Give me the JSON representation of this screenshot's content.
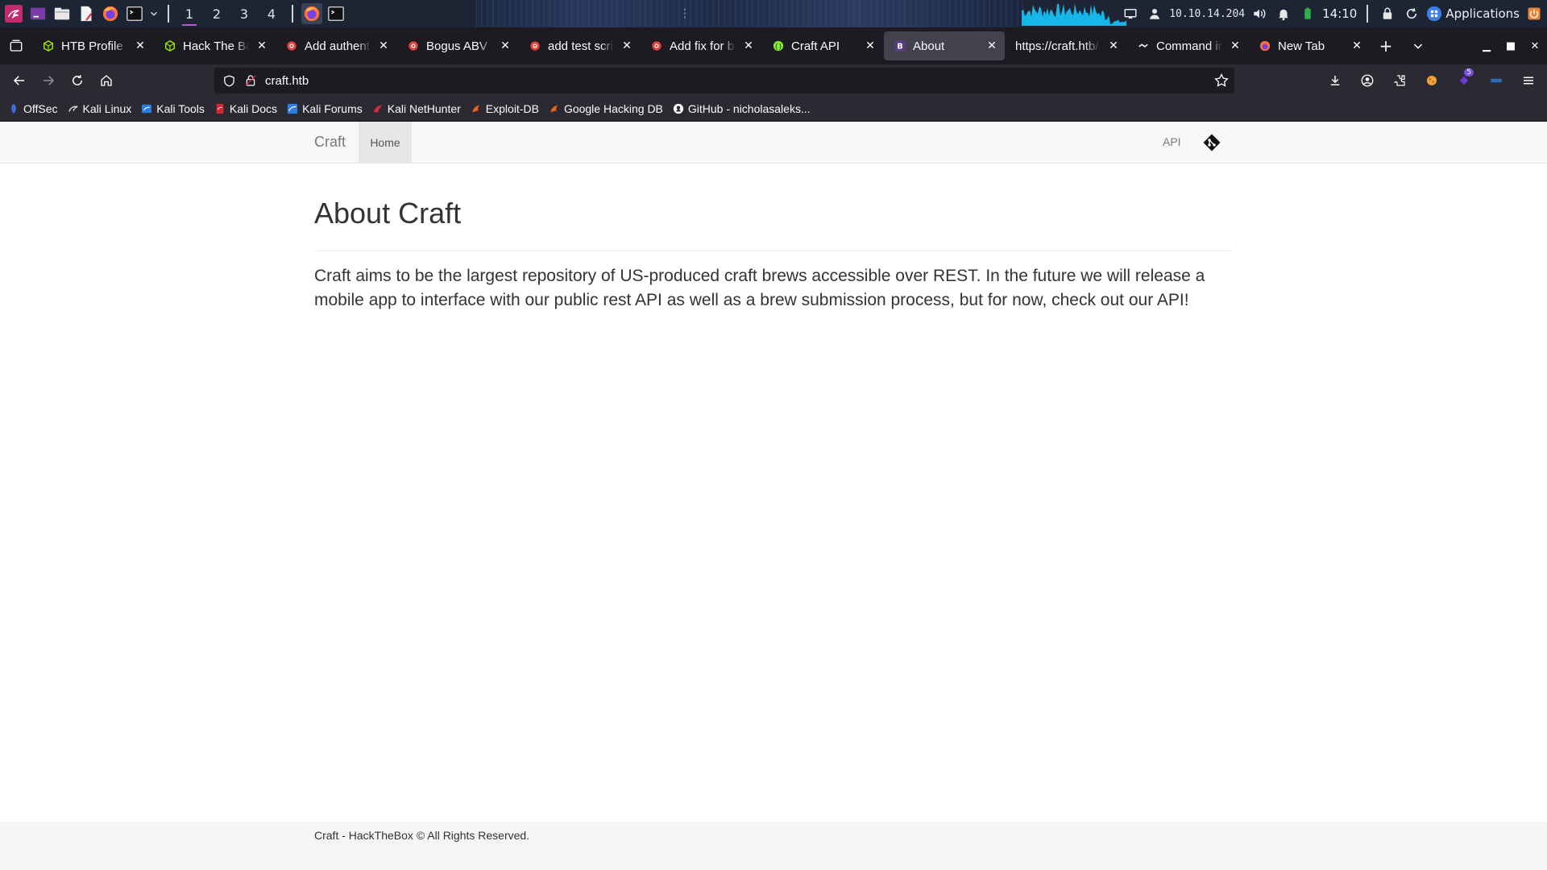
{
  "taskbar": {
    "workspaces": [
      "1",
      "2",
      "3",
      "4"
    ],
    "ip": "10.10.14.204",
    "clock": "14:10",
    "applications_label": "Applications"
  },
  "browser": {
    "tabs": [
      {
        "title": "HTB Profile | HTB",
        "icon": "htb-cube-icon"
      },
      {
        "title": "Hack The Box :: Hack The Box",
        "icon": "htb-cube-icon"
      },
      {
        "title": "Add authentication",
        "icon": "gogs-icon"
      },
      {
        "title": "Bogus ABV values",
        "icon": "gogs-icon"
      },
      {
        "title": "add test script",
        "icon": "gogs-icon"
      },
      {
        "title": "Add fix for bogus ABV",
        "icon": "gogs-icon"
      },
      {
        "title": "Craft API",
        "icon": "swagger-icon"
      },
      {
        "title": "About",
        "icon": "bootstrap-icon",
        "active": true
      },
      {
        "title": "https://craft.htb/",
        "icon": "none"
      },
      {
        "title": "Command injection",
        "icon": "hacktricks-icon"
      },
      {
        "title": "New Tab",
        "icon": "firefox-icon"
      }
    ],
    "url": "craft.htb",
    "bookmarks": [
      {
        "label": "OffSec",
        "icon": "offsec-icon"
      },
      {
        "label": "Kali Linux",
        "icon": "kali-icon"
      },
      {
        "label": "Kali Tools",
        "icon": "kali-tools-icon"
      },
      {
        "label": "Kali Docs",
        "icon": "kali-docs-icon"
      },
      {
        "label": "Kali Forums",
        "icon": "kali-forums-icon"
      },
      {
        "label": "Kali NetHunter",
        "icon": "nethunter-icon"
      },
      {
        "label": "Exploit-DB",
        "icon": "exploitdb-icon"
      },
      {
        "label": "Google Hacking DB",
        "icon": "ghdb-icon"
      },
      {
        "label": "GitHub - nicholasaleks...",
        "icon": "github-icon"
      }
    ],
    "extensions_badge": "5"
  },
  "site": {
    "brand": "Craft",
    "nav_home": "Home",
    "nav_api": "API",
    "title": "About Craft",
    "body": "Craft aims to be the largest repository of US-produced craft brews accessible over REST. In the future we will release a mobile app to interface with our public rest API as well as a brew submission process, but for now, check out our API!",
    "footer": "Craft - HackTheBox © All Rights Reserved."
  },
  "colors": {
    "taskbar_bg": "#1d2433",
    "tabstrip_bg": "#1c1b22",
    "toolbar_bg": "#2b2a33",
    "active_tab": "#42414d",
    "site_nav_bg": "#f8f8f8",
    "text": "#333333"
  }
}
